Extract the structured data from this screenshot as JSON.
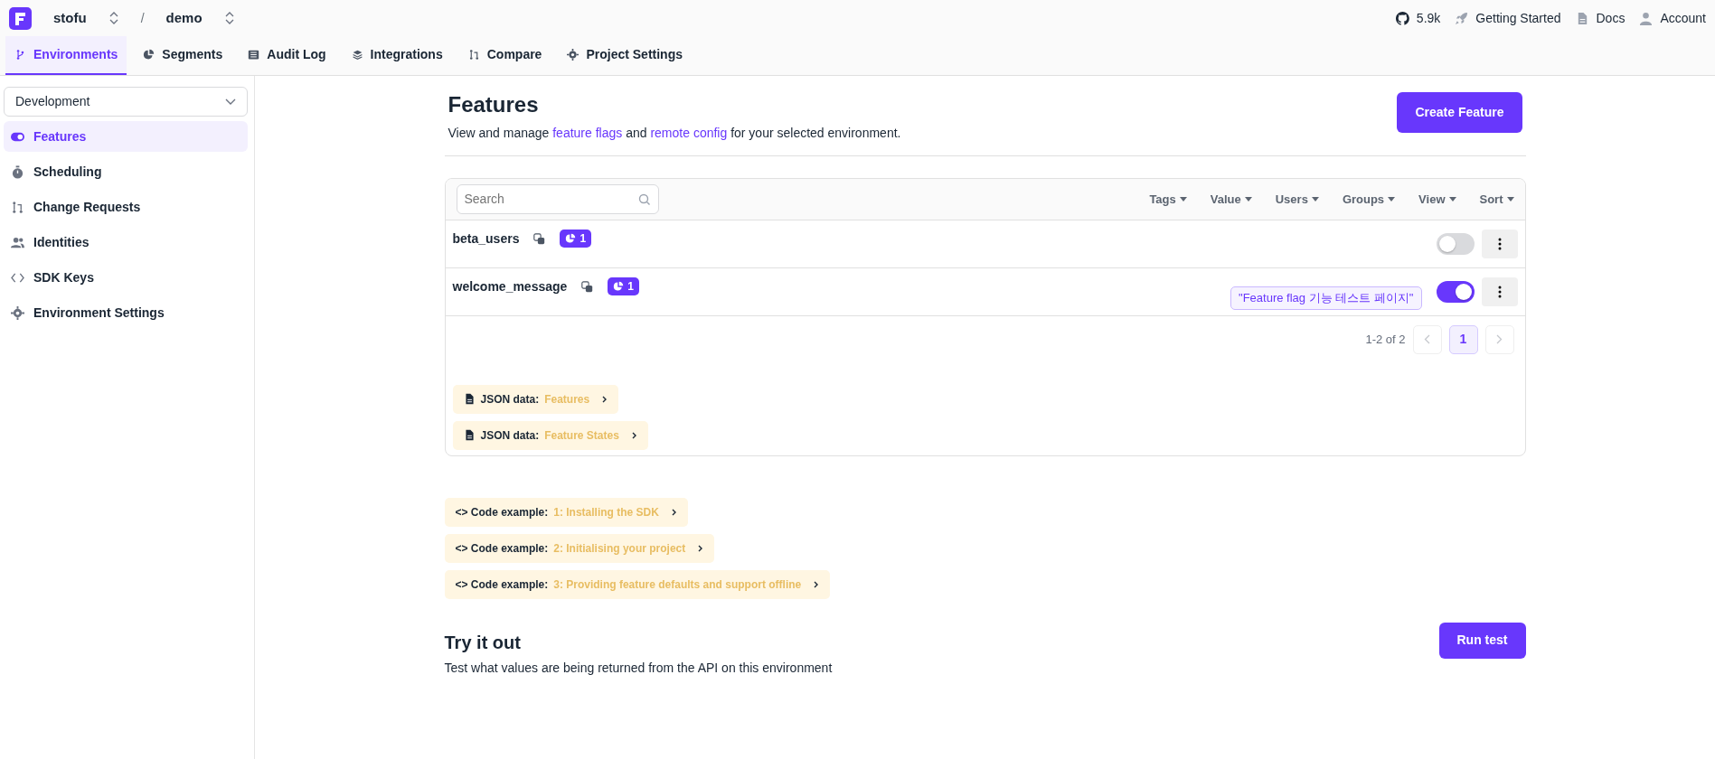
{
  "org": {
    "name": "stofu"
  },
  "project": {
    "name": "demo"
  },
  "separator": "/",
  "top_links": [
    {
      "kind": "github",
      "label": "5.9k"
    },
    {
      "kind": "rocket",
      "label": "Getting Started"
    },
    {
      "kind": "doc",
      "label": "Docs"
    },
    {
      "kind": "user",
      "label": "Account"
    }
  ],
  "tabs": [
    {
      "kind": "branch",
      "label": "Environments",
      "selected": true
    },
    {
      "kind": "pie",
      "label": "Segments",
      "selected": false
    },
    {
      "kind": "list",
      "label": "Audit Log",
      "selected": false
    },
    {
      "kind": "layers",
      "label": "Integrations",
      "selected": false
    },
    {
      "kind": "compare",
      "label": "Compare",
      "selected": false
    },
    {
      "kind": "gear",
      "label": "Project Settings",
      "selected": false
    }
  ],
  "sidebar": {
    "environment": "Development",
    "items": [
      {
        "kind": "toggle",
        "label": "Features",
        "selected": true
      },
      {
        "kind": "timer",
        "label": "Scheduling",
        "selected": false
      },
      {
        "kind": "compare",
        "label": "Change Requests",
        "selected": false
      },
      {
        "kind": "people",
        "label": "Identities",
        "selected": false
      },
      {
        "kind": "code",
        "label": "SDK Keys",
        "selected": false
      },
      {
        "kind": "gear",
        "label": "Environment Settings",
        "selected": false
      }
    ]
  },
  "page": {
    "title": "Features",
    "subtitle": [
      {
        "kind": "text",
        "text": "View and manage "
      },
      {
        "kind": "link",
        "text": "feature flags"
      },
      {
        "kind": "text",
        "text": " and "
      },
      {
        "kind": "link",
        "text": "remote config"
      },
      {
        "kind": "text",
        "text": " for your selected environment."
      }
    ],
    "create_button": "Create Feature"
  },
  "table": {
    "search": {
      "placeholder": "Search"
    },
    "filters": [
      "Tags",
      "Value",
      "Users",
      "Groups",
      "View",
      "Sort"
    ],
    "rows": [
      {
        "name": "beta_users",
        "segments": "1",
        "on": false
      },
      {
        "name": "welcome_message",
        "segments": "1",
        "value": "\"Feature flag 기능 테스트 페이지\"",
        "on": true
      }
    ],
    "pagination": {
      "range": "1-2 of 2",
      "pages": [
        {
          "label": "1",
          "selected": true
        }
      ]
    },
    "json_links": [
      {
        "label": "JSON data:",
        "title": "Features"
      },
      {
        "label": "JSON data:",
        "title": "Feature States"
      }
    ]
  },
  "code_examples": [
    {
      "prefix": "<>",
      "label": "Code example:",
      "title": "1: Installing the SDK"
    },
    {
      "prefix": "<>",
      "label": "Code example:",
      "title": "2: Initialising your project"
    },
    {
      "prefix": "<>",
      "label": "Code example:",
      "title": "3: Providing feature defaults and support offline"
    }
  ],
  "try_it": {
    "title": "Try it out",
    "text": "Test what values are being returned from the API on this environment",
    "button": "Run test"
  }
}
